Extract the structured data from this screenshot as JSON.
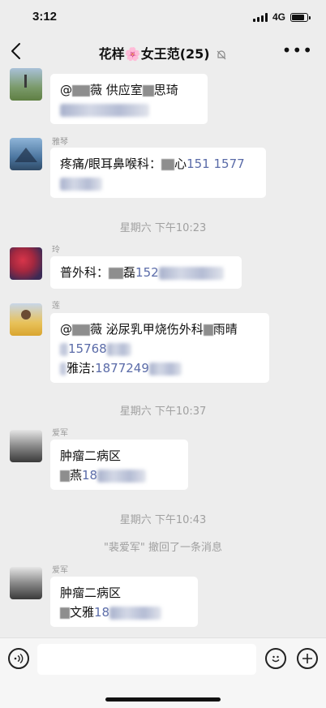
{
  "status": {
    "time": "3:12",
    "network": "4G",
    "battery_level": 0.75
  },
  "nav": {
    "back_icon": "chevron-left-icon",
    "title_before": "花样",
    "title_flower": "🌸",
    "title_after": "女王范(25)",
    "mute_icon": "bell-muted-icon",
    "more_label": "•••"
  },
  "messages": [
    {
      "name": "",
      "line1_a": "@",
      "line1_b": "薇  供应室",
      "line1_c": "思琦",
      "line2": ""
    },
    {
      "name": "雅琴",
      "line1_a": "疼痛/眼耳鼻喉科：",
      "line1_b": "心",
      "line1_phone": "151 1577",
      "line2": ""
    },
    {
      "name": "玲",
      "line1_a": "普外科：",
      "line1_b": "磊",
      "line1_phone": "152"
    },
    {
      "name": "莲",
      "line1_a": "@",
      "line1_b": "薇  泌尿乳甲烧伤外科",
      "line1_c": "雨晴",
      "line2_phone": "15768",
      "line3_a": "雅洁:",
      "line3_phone": "1877249"
    },
    {
      "name": "爱军",
      "line1": "肿瘤二病区",
      "line2_a": "燕",
      "line2_phone": "18"
    },
    {
      "name": "爱军",
      "line1": "肿瘤二病区",
      "line2_a": "文雅",
      "line2_phone": "18"
    }
  ],
  "timestamps": [
    "星期六 下午10:23",
    "星期六 下午10:37",
    "星期六 下午10:43"
  ],
  "recall_notice": "\"裴爱军\" 撤回了一条消息",
  "input": {
    "voice_icon": "voice-icon",
    "emoji_icon": "emoji-icon",
    "plus_icon": "plus-icon",
    "placeholder": ""
  }
}
